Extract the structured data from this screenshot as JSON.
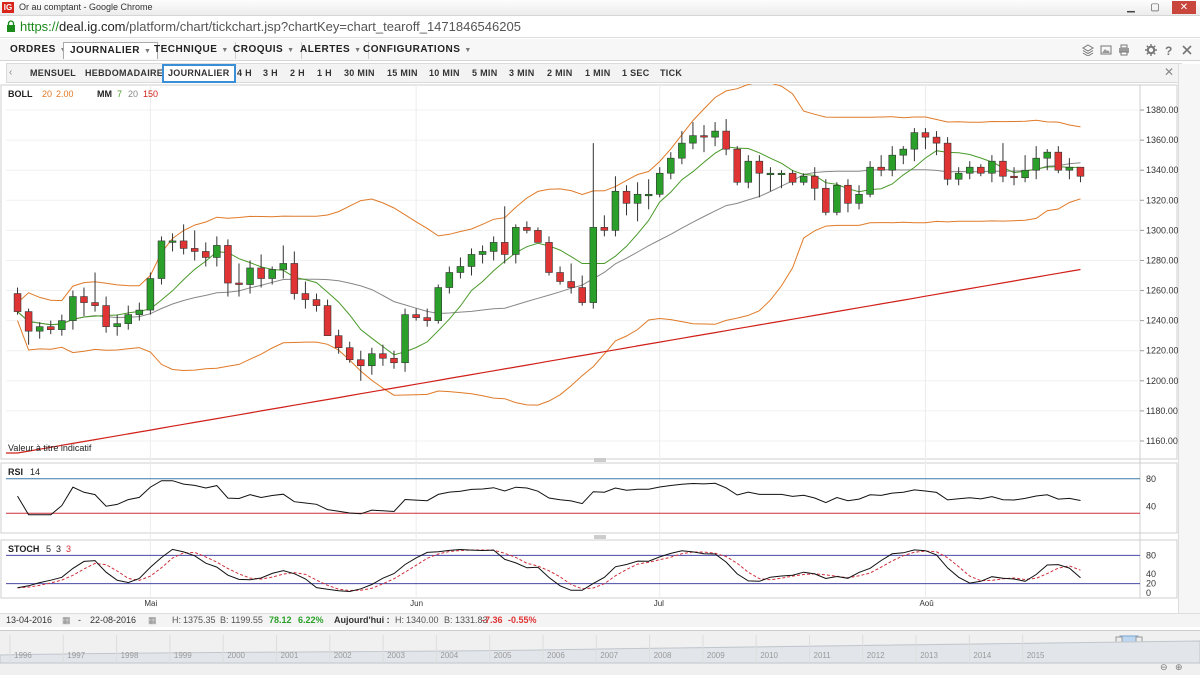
{
  "window": {
    "title": "Or au comptant - Google Chrome",
    "logo": "IG"
  },
  "address": {
    "proto": "https://",
    "host": "deal.ig.com",
    "path": "/platform/chart/tickchart.jsp?chartKey=chart_tearoff_1471846546205"
  },
  "menus": [
    {
      "label": "ORDRES"
    },
    {
      "label": "JOURNALIER"
    },
    {
      "label": "TECHNIQUE"
    },
    {
      "label": "CROQUIS"
    },
    {
      "label": "ALERTES"
    },
    {
      "label": "CONFIGURATIONS"
    }
  ],
  "timeframes": [
    "MENSUEL",
    "HEBDOMADAIRE",
    "JOURNALIER",
    "4 H",
    "3 H",
    "2 H",
    "1 H",
    "30 MIN",
    "15 MIN",
    "10 MIN",
    "5 MIN",
    "3 MIN",
    "2 MIN",
    "1 MIN",
    "1 SEC",
    "TICK"
  ],
  "active_timeframe": "JOURNALIER",
  "legend": {
    "boll_name": "BOLL",
    "boll_p1": "20",
    "boll_p2": "2.00",
    "mm_name": "MM",
    "mm_p1": "7",
    "mm_p2": "20",
    "mm_p3": "150"
  },
  "indicative_note": "Valeur à titre indicatif",
  "rsi_label": "RSI",
  "rsi_period": "14",
  "stoch_label": "STOCH",
  "stoch_p1": "5",
  "stoch_p2": "3",
  "stoch_p3": "3",
  "colors": {
    "up": "#2aa02a",
    "down": "#e03434",
    "boll": "#e07a28",
    "mm7": "#4a9a2a",
    "mm20": "#888888",
    "mm150": "#d0201a",
    "rsi_upper": "#3a7ca8",
    "rsi_lower": "#d0303a"
  },
  "chart_data": {
    "type": "candlestick",
    "price_ticks": [
      "1380.00",
      "1360.00",
      "1340.00",
      "1320.00",
      "1300.00",
      "1280.00",
      "1260.00",
      "1240.00",
      "1220.00",
      "1200.00",
      "1180.00",
      "1160.00"
    ],
    "ylim": [
      1150,
      1392
    ],
    "month_labels": [
      "Mai",
      "Jun",
      "Jul",
      "Aoû"
    ],
    "month_index": [
      12,
      36,
      58,
      82
    ],
    "rsi_ticks": [
      "80",
      "40"
    ],
    "stoch_ticks": [
      "80",
      "40",
      "20",
      "0"
    ],
    "candles": [
      [
        1258,
        1262,
        1244,
        1246
      ],
      [
        1246,
        1248,
        1224,
        1233
      ],
      [
        1233,
        1239,
        1228,
        1236
      ],
      [
        1236,
        1240,
        1231,
        1234
      ],
      [
        1234,
        1244,
        1230,
        1240
      ],
      [
        1240,
        1260,
        1234,
        1256
      ],
      [
        1256,
        1262,
        1243,
        1252
      ],
      [
        1252,
        1272,
        1246,
        1250
      ],
      [
        1250,
        1256,
        1232,
        1236
      ],
      [
        1236,
        1244,
        1230,
        1238
      ],
      [
        1238,
        1250,
        1234,
        1244
      ],
      [
        1244,
        1252,
        1240,
        1247
      ],
      [
        1247,
        1272,
        1244,
        1268
      ],
      [
        1268,
        1296,
        1264,
        1293
      ],
      [
        1293,
        1298,
        1286,
        1293
      ],
      [
        1293,
        1304,
        1284,
        1288
      ],
      [
        1288,
        1300,
        1280,
        1286
      ],
      [
        1286,
        1292,
        1276,
        1282
      ],
      [
        1282,
        1296,
        1276,
        1290
      ],
      [
        1290,
        1294,
        1256,
        1265
      ],
      [
        1265,
        1278,
        1256,
        1264
      ],
      [
        1264,
        1280,
        1258,
        1275
      ],
      [
        1275,
        1284,
        1262,
        1268
      ],
      [
        1268,
        1276,
        1264,
        1274
      ],
      [
        1274,
        1290,
        1268,
        1278
      ],
      [
        1278,
        1286,
        1254,
        1258
      ],
      [
        1258,
        1266,
        1248,
        1254
      ],
      [
        1254,
        1258,
        1246,
        1250
      ],
      [
        1250,
        1254,
        1230,
        1230
      ],
      [
        1230,
        1234,
        1218,
        1222
      ],
      [
        1222,
        1226,
        1212,
        1214
      ],
      [
        1214,
        1220,
        1200,
        1210
      ],
      [
        1210,
        1222,
        1204,
        1218
      ],
      [
        1218,
        1224,
        1210,
        1215
      ],
      [
        1215,
        1220,
        1208,
        1212
      ],
      [
        1212,
        1248,
        1206,
        1244
      ],
      [
        1244,
        1248,
        1240,
        1242
      ],
      [
        1242,
        1248,
        1236,
        1240
      ],
      [
        1240,
        1264,
        1238,
        1262
      ],
      [
        1262,
        1276,
        1258,
        1272
      ],
      [
        1272,
        1282,
        1268,
        1276
      ],
      [
        1276,
        1288,
        1270,
        1284
      ],
      [
        1284,
        1290,
        1278,
        1286
      ],
      [
        1286,
        1296,
        1280,
        1292
      ],
      [
        1292,
        1316,
        1278,
        1284
      ],
      [
        1284,
        1304,
        1278,
        1302
      ],
      [
        1302,
        1306,
        1298,
        1300
      ],
      [
        1300,
        1302,
        1292,
        1292
      ],
      [
        1292,
        1296,
        1270,
        1272
      ],
      [
        1272,
        1276,
        1264,
        1266
      ],
      [
        1266,
        1278,
        1258,
        1262
      ],
      [
        1262,
        1270,
        1250,
        1252
      ],
      [
        1252,
        1358,
        1248,
        1302
      ],
      [
        1302,
        1310,
        1296,
        1300
      ],
      [
        1300,
        1336,
        1296,
        1326
      ],
      [
        1326,
        1330,
        1310,
        1318
      ],
      [
        1318,
        1332,
        1306,
        1324
      ],
      [
        1324,
        1334,
        1314,
        1324
      ],
      [
        1324,
        1342,
        1322,
        1338
      ],
      [
        1338,
        1352,
        1334,
        1348
      ],
      [
        1348,
        1366,
        1344,
        1358
      ],
      [
        1358,
        1372,
        1354,
        1363
      ],
      [
        1363,
        1370,
        1352,
        1362
      ],
      [
        1362,
        1372,
        1356,
        1366
      ],
      [
        1366,
        1374,
        1350,
        1354
      ],
      [
        1354,
        1356,
        1330,
        1332
      ],
      [
        1332,
        1350,
        1328,
        1346
      ],
      [
        1346,
        1350,
        1322,
        1338
      ],
      [
        1338,
        1342,
        1326,
        1338
      ],
      [
        1338,
        1340,
        1328,
        1338
      ],
      [
        1338,
        1340,
        1330,
        1332
      ],
      [
        1332,
        1338,
        1330,
        1336
      ],
      [
        1336,
        1342,
        1320,
        1328
      ],
      [
        1328,
        1334,
        1310,
        1312
      ],
      [
        1312,
        1332,
        1310,
        1330
      ],
      [
        1330,
        1334,
        1312,
        1318
      ],
      [
        1318,
        1330,
        1314,
        1324
      ],
      [
        1324,
        1346,
        1322,
        1342
      ],
      [
        1342,
        1350,
        1336,
        1340
      ],
      [
        1340,
        1356,
        1336,
        1350
      ],
      [
        1350,
        1356,
        1344,
        1354
      ],
      [
        1354,
        1368,
        1346,
        1365
      ],
      [
        1365,
        1368,
        1354,
        1362
      ],
      [
        1362,
        1366,
        1350,
        1358
      ],
      [
        1358,
        1362,
        1330,
        1334
      ],
      [
        1334,
        1342,
        1330,
        1338
      ],
      [
        1338,
        1346,
        1334,
        1342
      ],
      [
        1342,
        1344,
        1336,
        1338
      ],
      [
        1338,
        1350,
        1332,
        1346
      ],
      [
        1346,
        1358,
        1332,
        1336
      ],
      [
        1336,
        1342,
        1330,
        1335
      ],
      [
        1335,
        1350,
        1332,
        1340
      ],
      [
        1340,
        1356,
        1334,
        1348
      ],
      [
        1348,
        1354,
        1340,
        1352
      ],
      [
        1352,
        1356,
        1338,
        1340
      ],
      [
        1340,
        1348,
        1334,
        1342
      ],
      [
        1342,
        1342,
        1332,
        1336
      ]
    ],
    "xlabel": "",
    "ylabel": ""
  },
  "datebar": {
    "from": "13-04-2016",
    "to": "22-08-2016",
    "high_label": "H:",
    "high": "1375.35",
    "low_label": "B:",
    "low": "1199.55",
    "chg": "78.12",
    "chg_pct": "6.22%",
    "today_label": "Aujourd'hui :",
    "today_h_label": "H:",
    "today_h": "1340.00",
    "today_b_label": "B:",
    "today_b": "1331.83",
    "today_chg": "-7.36",
    "today_chg_pct": "-0.55%"
  },
  "navigator_years": [
    "1996",
    "1997",
    "1998",
    "1999",
    "2000",
    "2001",
    "2002",
    "2003",
    "2004",
    "2005",
    "2006",
    "2007",
    "2008",
    "2009",
    "2010",
    "2011",
    "2012",
    "2013",
    "2014",
    "2015"
  ]
}
